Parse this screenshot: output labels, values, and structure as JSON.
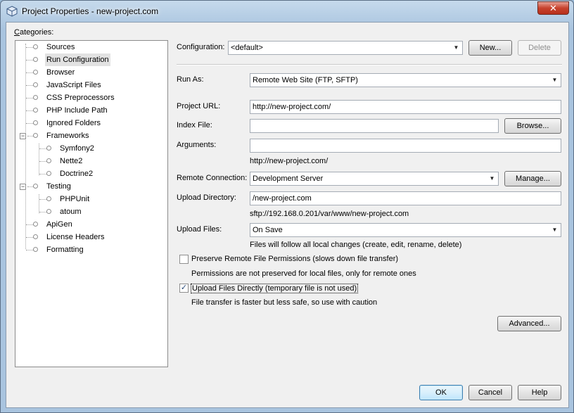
{
  "window": {
    "title": "Project Properties - new-project.com",
    "close_glyph": "✕"
  },
  "categories": {
    "label": "Categories:",
    "items": [
      {
        "label": "Sources"
      },
      {
        "label": "Run Configuration"
      },
      {
        "label": "Browser"
      },
      {
        "label": "JavaScript Files"
      },
      {
        "label": "CSS Preprocessors"
      },
      {
        "label": "PHP Include Path"
      },
      {
        "label": "Ignored Folders"
      },
      {
        "label": "Frameworks"
      },
      {
        "label": "Symfony2"
      },
      {
        "label": "Nette2"
      },
      {
        "label": "Doctrine2"
      },
      {
        "label": "Testing"
      },
      {
        "label": "PHPUnit"
      },
      {
        "label": "atoum"
      },
      {
        "label": "ApiGen"
      },
      {
        "label": "License Headers"
      },
      {
        "label": "Formatting"
      }
    ],
    "selected": "Run Configuration"
  },
  "configuration": {
    "label": "Configuration:",
    "value": "<default>",
    "new_button": "New...",
    "delete_button": "Delete"
  },
  "run_as": {
    "label": "Run As:",
    "value": "Remote Web Site (FTP, SFTP)"
  },
  "project_url": {
    "label": "Project URL:",
    "value": "http://new-project.com/"
  },
  "index_file": {
    "label": "Index File:",
    "value": "",
    "browse_button": "Browse..."
  },
  "arguments": {
    "label": "Arguments:",
    "value": "",
    "hint": "http://new-project.com/"
  },
  "remote_connection": {
    "label": "Remote Connection:",
    "value": "Development Server",
    "manage_button": "Manage..."
  },
  "upload_directory": {
    "label": "Upload Directory:",
    "value": "/new-project.com",
    "hint": "sftp://192.168.0.201/var/www/new-project.com"
  },
  "upload_files": {
    "label": "Upload Files:",
    "value": "On Save",
    "hint": "Files will follow all local changes (create, edit, rename, delete)"
  },
  "preserve_permissions": {
    "label": "Preserve Remote File Permissions (slows down file transfer)",
    "checked": false,
    "hint": "Permissions are not preserved for local files, only for remote ones"
  },
  "upload_directly": {
    "label": "Upload Files Directly (temporary file is not used)",
    "checked": true,
    "check_glyph": "✓",
    "hint": "File transfer is faster but less safe, so use with caution"
  },
  "advanced_button": "Advanced...",
  "footer": {
    "ok": "OK",
    "cancel": "Cancel",
    "help": "Help"
  }
}
